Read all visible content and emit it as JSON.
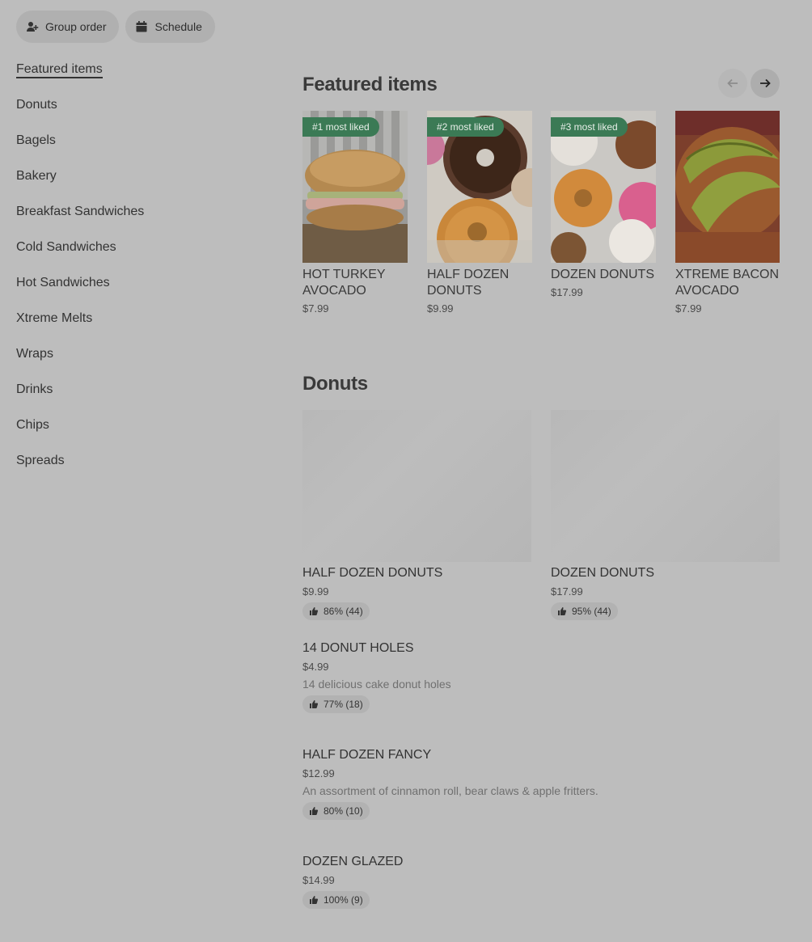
{
  "top_actions": {
    "group_order": "Group order",
    "schedule": "Schedule"
  },
  "sidebar": {
    "items": [
      {
        "label": "Featured items"
      },
      {
        "label": "Donuts"
      },
      {
        "label": "Bagels"
      },
      {
        "label": "Bakery"
      },
      {
        "label": "Breakfast Sandwiches"
      },
      {
        "label": "Cold Sandwiches"
      },
      {
        "label": "Hot Sandwiches"
      },
      {
        "label": "Xtreme Melts"
      },
      {
        "label": "Wraps"
      },
      {
        "label": "Drinks"
      },
      {
        "label": "Chips"
      },
      {
        "label": "Spreads"
      }
    ]
  },
  "featured": {
    "title": "Featured items",
    "items": [
      {
        "badge": "#1 most liked",
        "name": "HOT TURKEY AVOCADO",
        "price": "$7.99"
      },
      {
        "badge": "#2 most liked",
        "name": "HALF DOZEN DONUTS",
        "price": "$9.99"
      },
      {
        "badge": "#3 most liked",
        "name": "DOZEN DONUTS",
        "price": "$17.99"
      },
      {
        "badge": "",
        "name": "XTREME BACON AVOCADO",
        "price": "$7.99"
      }
    ]
  },
  "donuts": {
    "title": "Donuts",
    "cards": [
      {
        "name": "HALF DOZEN DONUTS",
        "price": "$9.99",
        "rating": "86% (44)"
      },
      {
        "name": "DOZEN DONUTS",
        "price": "$17.99",
        "rating": "95% (44)"
      }
    ],
    "list": [
      {
        "name": "14 DONUT HOLES",
        "price": "$4.99",
        "desc": "14 delicious cake donut holes",
        "rating": "77% (18)"
      },
      {
        "name": "HALF DOZEN FANCY",
        "price": "$12.99",
        "desc": "An assortment of cinnamon roll, bear claws & apple fritters.",
        "rating": "80% (10)"
      },
      {
        "name": "DOZEN GLAZED",
        "price": "$14.99",
        "desc": "",
        "rating": "100% (9)"
      }
    ]
  },
  "colors": {
    "badge_green": "#3b7a55",
    "background": "#bdbdbd"
  },
  "icons": {
    "group_order": "person-plus-icon",
    "schedule": "calendar-icon",
    "prev": "arrow-left-icon",
    "next": "arrow-right-icon",
    "rating": "thumbs-up-icon"
  }
}
